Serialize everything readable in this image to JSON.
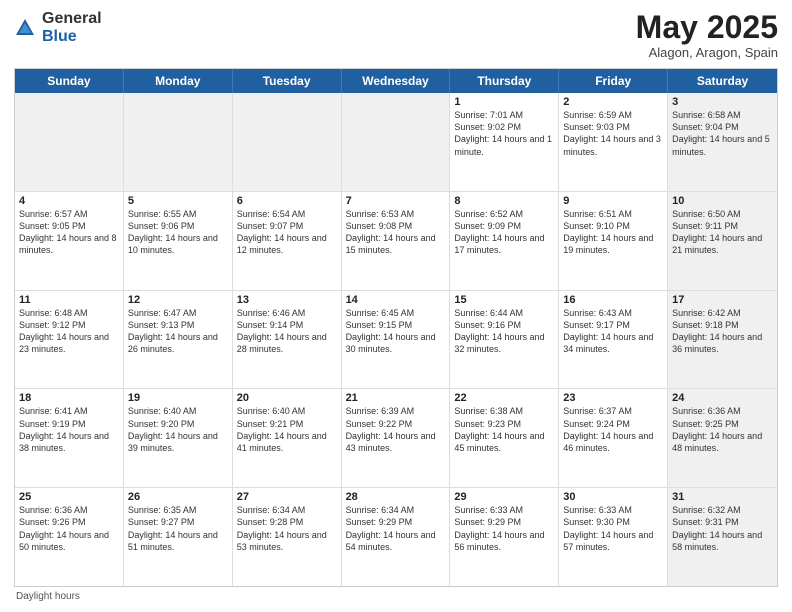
{
  "logo": {
    "general": "General",
    "blue": "Blue"
  },
  "title": "May 2025",
  "subtitle": "Alagon, Aragon, Spain",
  "header_days": [
    "Sunday",
    "Monday",
    "Tuesday",
    "Wednesday",
    "Thursday",
    "Friday",
    "Saturday"
  ],
  "weeks": [
    [
      {
        "day": "",
        "text": "",
        "shaded": true
      },
      {
        "day": "",
        "text": "",
        "shaded": true
      },
      {
        "day": "",
        "text": "",
        "shaded": true
      },
      {
        "day": "",
        "text": "",
        "shaded": true
      },
      {
        "day": "1",
        "text": "Sunrise: 7:01 AM\nSunset: 9:02 PM\nDaylight: 14 hours and 1 minute."
      },
      {
        "day": "2",
        "text": "Sunrise: 6:59 AM\nSunset: 9:03 PM\nDaylight: 14 hours and 3 minutes."
      },
      {
        "day": "3",
        "text": "Sunrise: 6:58 AM\nSunset: 9:04 PM\nDaylight: 14 hours and 5 minutes.",
        "shaded": true
      }
    ],
    [
      {
        "day": "4",
        "text": "Sunrise: 6:57 AM\nSunset: 9:05 PM\nDaylight: 14 hours and 8 minutes."
      },
      {
        "day": "5",
        "text": "Sunrise: 6:55 AM\nSunset: 9:06 PM\nDaylight: 14 hours and 10 minutes."
      },
      {
        "day": "6",
        "text": "Sunrise: 6:54 AM\nSunset: 9:07 PM\nDaylight: 14 hours and 12 minutes."
      },
      {
        "day": "7",
        "text": "Sunrise: 6:53 AM\nSunset: 9:08 PM\nDaylight: 14 hours and 15 minutes."
      },
      {
        "day": "8",
        "text": "Sunrise: 6:52 AM\nSunset: 9:09 PM\nDaylight: 14 hours and 17 minutes."
      },
      {
        "day": "9",
        "text": "Sunrise: 6:51 AM\nSunset: 9:10 PM\nDaylight: 14 hours and 19 minutes."
      },
      {
        "day": "10",
        "text": "Sunrise: 6:50 AM\nSunset: 9:11 PM\nDaylight: 14 hours and 21 minutes.",
        "shaded": true
      }
    ],
    [
      {
        "day": "11",
        "text": "Sunrise: 6:48 AM\nSunset: 9:12 PM\nDaylight: 14 hours and 23 minutes."
      },
      {
        "day": "12",
        "text": "Sunrise: 6:47 AM\nSunset: 9:13 PM\nDaylight: 14 hours and 26 minutes."
      },
      {
        "day": "13",
        "text": "Sunrise: 6:46 AM\nSunset: 9:14 PM\nDaylight: 14 hours and 28 minutes."
      },
      {
        "day": "14",
        "text": "Sunrise: 6:45 AM\nSunset: 9:15 PM\nDaylight: 14 hours and 30 minutes."
      },
      {
        "day": "15",
        "text": "Sunrise: 6:44 AM\nSunset: 9:16 PM\nDaylight: 14 hours and 32 minutes."
      },
      {
        "day": "16",
        "text": "Sunrise: 6:43 AM\nSunset: 9:17 PM\nDaylight: 14 hours and 34 minutes."
      },
      {
        "day": "17",
        "text": "Sunrise: 6:42 AM\nSunset: 9:18 PM\nDaylight: 14 hours and 36 minutes.",
        "shaded": true
      }
    ],
    [
      {
        "day": "18",
        "text": "Sunrise: 6:41 AM\nSunset: 9:19 PM\nDaylight: 14 hours and 38 minutes."
      },
      {
        "day": "19",
        "text": "Sunrise: 6:40 AM\nSunset: 9:20 PM\nDaylight: 14 hours and 39 minutes."
      },
      {
        "day": "20",
        "text": "Sunrise: 6:40 AM\nSunset: 9:21 PM\nDaylight: 14 hours and 41 minutes."
      },
      {
        "day": "21",
        "text": "Sunrise: 6:39 AM\nSunset: 9:22 PM\nDaylight: 14 hours and 43 minutes."
      },
      {
        "day": "22",
        "text": "Sunrise: 6:38 AM\nSunset: 9:23 PM\nDaylight: 14 hours and 45 minutes."
      },
      {
        "day": "23",
        "text": "Sunrise: 6:37 AM\nSunset: 9:24 PM\nDaylight: 14 hours and 46 minutes."
      },
      {
        "day": "24",
        "text": "Sunrise: 6:36 AM\nSunset: 9:25 PM\nDaylight: 14 hours and 48 minutes.",
        "shaded": true
      }
    ],
    [
      {
        "day": "25",
        "text": "Sunrise: 6:36 AM\nSunset: 9:26 PM\nDaylight: 14 hours and 50 minutes."
      },
      {
        "day": "26",
        "text": "Sunrise: 6:35 AM\nSunset: 9:27 PM\nDaylight: 14 hours and 51 minutes."
      },
      {
        "day": "27",
        "text": "Sunrise: 6:34 AM\nSunset: 9:28 PM\nDaylight: 14 hours and 53 minutes."
      },
      {
        "day": "28",
        "text": "Sunrise: 6:34 AM\nSunset: 9:29 PM\nDaylight: 14 hours and 54 minutes."
      },
      {
        "day": "29",
        "text": "Sunrise: 6:33 AM\nSunset: 9:29 PM\nDaylight: 14 hours and 56 minutes."
      },
      {
        "day": "30",
        "text": "Sunrise: 6:33 AM\nSunset: 9:30 PM\nDaylight: 14 hours and 57 minutes."
      },
      {
        "day": "31",
        "text": "Sunrise: 6:32 AM\nSunset: 9:31 PM\nDaylight: 14 hours and 58 minutes.",
        "shaded": true
      }
    ]
  ],
  "footer": "Daylight hours"
}
